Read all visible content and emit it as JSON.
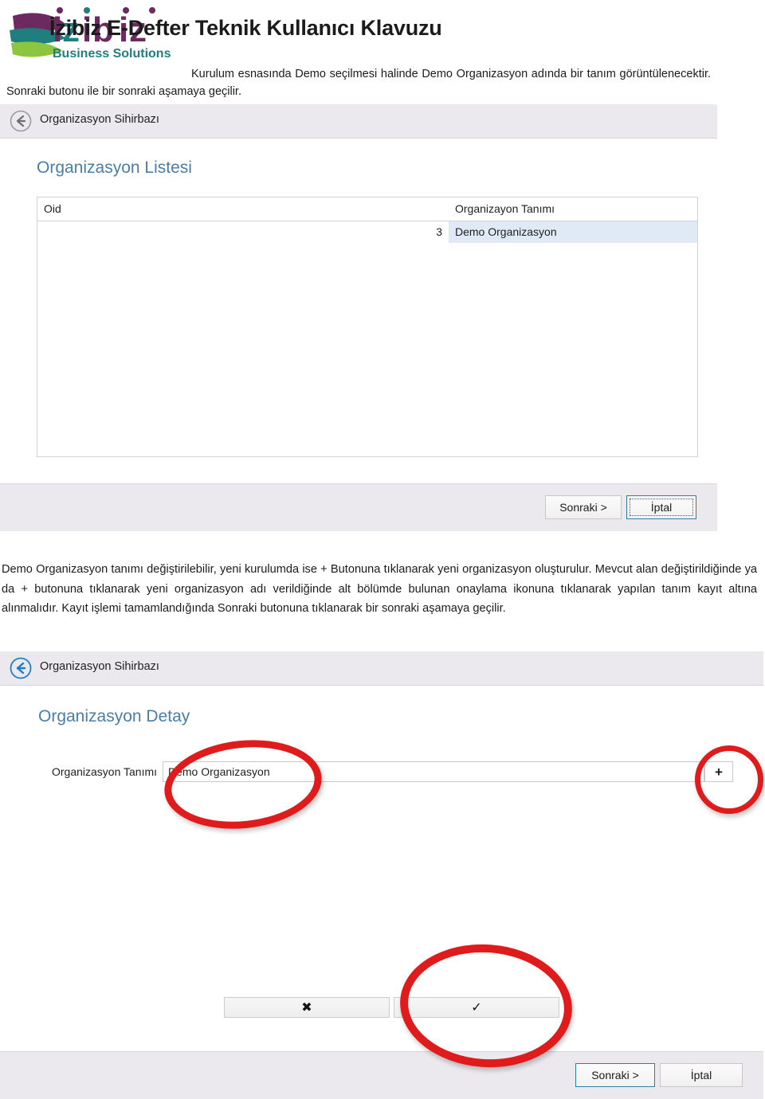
{
  "document": {
    "title": "İzibiz E-Defter Teknik Kullanıcı Klavuzu",
    "logo": {
      "wordmark": "izibiz",
      "tagline": "Business Solutions"
    },
    "intro_paragraph": "Kurulum esnasında Demo seçilmesi halinde Demo Organizasyon adında bir tanım görüntülenecektir. Sonraki butonu ile bir sonraki aşamaya geçilir.",
    "middle_paragraph": "Demo Organizasyon tanımı değiştirilebilir, yeni kurulumda ise + Butonuna tıklanarak yeni organizasyon oluşturulur. Mevcut alan değiştirildiğinde ya da + butonuna tıklanarak yeni organizasyon adı verildiğinde alt bölümde bulunan onaylama ikonuna tıklanarak yapılan tanım kayıt altına alınmalıdır. Kayıt işlemi tamamlandığında Sonraki butonuna tıklanarak bir sonraki aşamaya geçilir."
  },
  "screenshot_list": {
    "wizard_bar": {
      "back_icon": "back-arrow-icon",
      "title": "Organizasyon Sihirbazı"
    },
    "section_heading": "Organizasyon Listesi",
    "table": {
      "columns": [
        "Oid",
        "Organizayon Tanımı"
      ],
      "rows": [
        {
          "oid": "3",
          "tanim": "Demo Organizasyon",
          "selected": true
        }
      ]
    },
    "footer": {
      "next_label": "Sonraki >",
      "cancel_label": "İptal",
      "focused_button": "cancel"
    }
  },
  "screenshot_detail": {
    "wizard_bar": {
      "back_icon": "back-arrow-icon",
      "title": "Organizasyon Sihirbazı"
    },
    "section_heading": "Organizasyon Detay",
    "form": {
      "label": "Organizasyon Tanımı",
      "value": "Demo Organizasyon",
      "placeholder": "",
      "add_button_label": "+"
    },
    "actions": {
      "cancel_icon_label": "✖",
      "confirm_icon_label": "✓"
    },
    "footer": {
      "next_label": "Sonraki >",
      "cancel_label": "İptal",
      "focused_button": "next"
    }
  },
  "annotations": {
    "ring_color": "#e01b1b",
    "rings": [
      {
        "target": "organizasyon-tanimi-input"
      },
      {
        "target": "add-organization-button"
      },
      {
        "target": "confirm-button"
      }
    ]
  }
}
